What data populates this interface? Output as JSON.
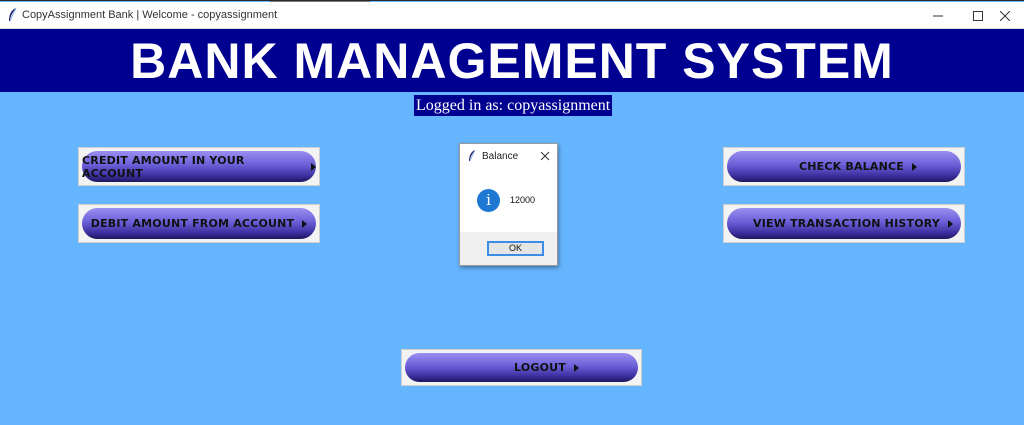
{
  "window": {
    "title": "CopyAssignment Bank | Welcome - copyassignment",
    "controls": {
      "minimize": "minimize-icon",
      "maximize": "maximize-icon",
      "close": "close-icon"
    }
  },
  "banner": {
    "title": "BANK MANAGEMENT SYSTEM"
  },
  "status": {
    "logged_in": "Logged in as: copyassignment"
  },
  "buttons": {
    "credit": "CREDIT AMOUNT IN YOUR ACCOUNT",
    "debit": "DEBIT AMOUNT FROM ACCOUNT",
    "check_balance": "CHECK BALANCE",
    "history": "VIEW TRANSACTION HISTORY",
    "logout": "LOGOUT"
  },
  "dialog": {
    "title": "Balance",
    "message": "12000",
    "ok_label": "OK",
    "icon": "info-icon"
  },
  "colors": {
    "background": "#66b5ff",
    "banner": "#000090",
    "button_gradient_top": "#9a8ff0",
    "button_gradient_bottom": "#1e165e",
    "info_icon": "#1f78d1"
  }
}
